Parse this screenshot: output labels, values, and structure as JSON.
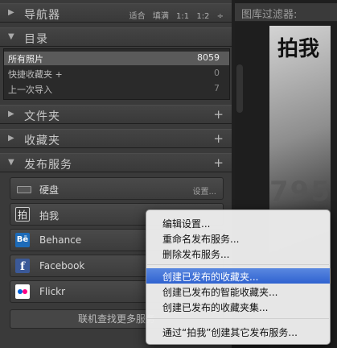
{
  "panels": {
    "navigator": {
      "title": "导航器",
      "options": [
        "适合",
        "填满",
        "1:1",
        "1:2"
      ]
    },
    "catalog": {
      "title": "目录",
      "items": [
        {
          "label": "所有照片",
          "count": "8059"
        },
        {
          "label": "快捷收藏夹 +",
          "count": "0"
        },
        {
          "label": "上一次导入",
          "count": "7"
        }
      ]
    },
    "folders": {
      "title": "文件夹"
    },
    "collections": {
      "title": "收藏夹"
    },
    "publish": {
      "title": "发布服务"
    }
  },
  "services": [
    {
      "name": "硬盘",
      "settings": "设置...",
      "icon": "hard-disk-icon"
    },
    {
      "name": "拍我",
      "icon": "paiwo-icon",
      "icon_glyph": "拍"
    },
    {
      "name": "Behance",
      "icon": "behance-icon",
      "icon_glyph": "Bē"
    },
    {
      "name": "Facebook",
      "icon": "facebook-icon",
      "icon_glyph": "f"
    },
    {
      "name": "Flickr",
      "icon": "flickr-icon"
    }
  ],
  "find_more": "联机查找更多服务",
  "filter": {
    "label": "图库过滤器:"
  },
  "photo": {
    "magazine_mark": "拍我",
    "watermark": "795"
  },
  "context_menu": {
    "group1": [
      "编辑设置...",
      "重命名发布服务...",
      "删除发布服务..."
    ],
    "group2": [
      "创建已发布的收藏夹...",
      "创建已发布的智能收藏夹...",
      "创建已发布的收藏夹集..."
    ],
    "group3": [
      "通过“拍我”创建其它发布服务..."
    ],
    "highlighted": "创建已发布的收藏夹..."
  },
  "colors": {
    "highlight": "#3a6fd8",
    "panel": "#3a3a3a"
  }
}
